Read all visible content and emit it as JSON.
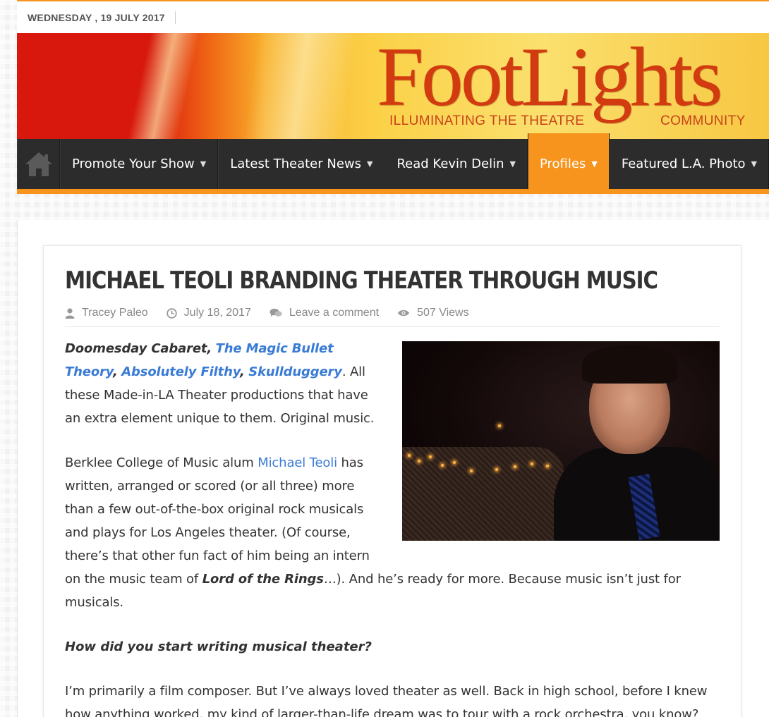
{
  "topbar": {
    "date": "WEDNESDAY , 19 JULY 2017"
  },
  "banner": {
    "logo_text": "FootLights",
    "tagline_left": "ILLUMINATING THE THEATRE",
    "tagline_right": "COMMUNITY"
  },
  "nav": {
    "home_icon": "home-icon",
    "items": [
      {
        "label": "Promote Your Show"
      },
      {
        "label": "Latest Theater News"
      },
      {
        "label": "Read Kevin Delin"
      },
      {
        "label": "Profiles"
      },
      {
        "label": "Featured L.A. Photo"
      }
    ],
    "active_index": 3
  },
  "colors": {
    "accent": "#f7941d",
    "nav_bg": "#2c2c2c",
    "link": "#3a7bd5"
  },
  "article": {
    "title": "MICHAEL TEOLI BRANDING THEATER THROUGH MUSIC",
    "meta": {
      "author": "Tracey Paleo",
      "date": "July 18, 2017",
      "comments": "Leave a comment",
      "views": "507 Views"
    },
    "para1": {
      "t1": "Doomesday Cabaret,",
      "l1": "The Magic Bullet Theory",
      "t2": ",",
      "l2": "Absolutely Filthy",
      "t3": ",",
      "l3": "Skullduggery",
      "t4": ".",
      "rest": "  All these Made-in-LA Theater productions that have an extra element unique to them.  Original music."
    },
    "para2": {
      "before": "Berklee College of Music alum ",
      "link": "Michael Teoli",
      "middle": " has written, arranged or scored (or all three) more than a few out-of-the-box original rock musicals and plays for Los Angeles theater. (Of course, there’s that other fun fact of him being an intern on the music team of ",
      "em": "Lord of the Rings",
      "after": "…). And he’s ready for more. Because music isn’t just for musicals."
    },
    "question1": "How did you start writing musical theater?",
    "para3": "I’m primarily a film composer. But I’ve always loved theater as well. Back in high school, before I knew how anything worked, my kind of larger-than-life dream was to tour with a rock orchestra, you know?"
  }
}
